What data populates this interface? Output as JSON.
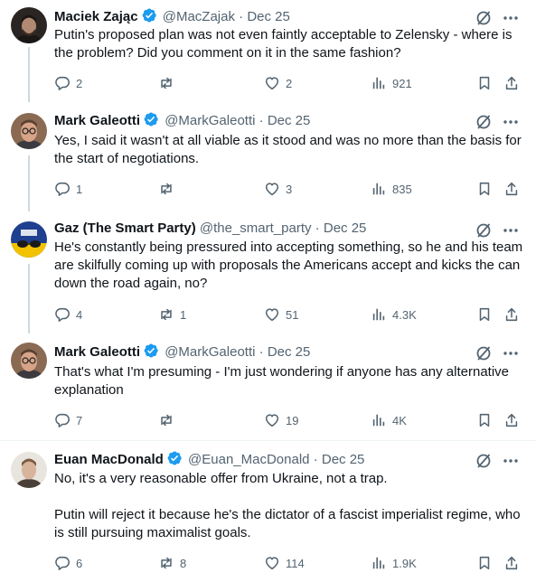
{
  "posts": [
    {
      "name": "Maciek Zając",
      "handle": "@MacZajak",
      "dot": "·",
      "date": "Dec 25",
      "text": "Putin's proposed plan was not even faintly acceptable to Zelensky - where is the problem? Did you comment on it in the same fashion?",
      "replies": "2",
      "reposts": "",
      "likes": "2",
      "views": "921"
    },
    {
      "name": "Mark Galeotti",
      "handle": "@MarkGaleotti",
      "dot": "·",
      "date": "Dec 25",
      "text": "Yes, I said it wasn't at all viable as it stood and was no more than the basis for the start of negotiations.",
      "replies": "1",
      "reposts": "",
      "likes": "3",
      "views": "835"
    },
    {
      "name": "Gaz (The Smart Party)",
      "handle": "@the_smart_party",
      "dot": "·",
      "date": "Dec 25",
      "text": "He's constantly being pressured into accepting something, so he and his team are skilfully coming up with proposals the Americans accept and kicks the can down the road again, no?",
      "replies": "4",
      "reposts": "1",
      "likes": "51",
      "views": "4.3K"
    },
    {
      "name": "Mark Galeotti",
      "handle": "@MarkGaleotti",
      "dot": "·",
      "date": "Dec 25",
      "text": "That's what I'm presuming - I'm just wondering if anyone has any alternative explanation",
      "replies": "7",
      "reposts": "",
      "likes": "19",
      "views": "4K"
    },
    {
      "name": "Euan MacDonald",
      "handle": "@Euan_MacDonald",
      "dot": "·",
      "date": "Dec 25",
      "text": "No, it's a very reasonable offer from Ukraine, not a trap.\n\nPutin will reject it because he's the dictator of a fascist imperialist regime, who is still pursuing maximalist goals.",
      "replies": "6",
      "reposts": "8",
      "likes": "114",
      "views": "1.9K"
    }
  ],
  "colors": {
    "verified": "#1d9bf0",
    "text": "#0f1419",
    "secondary": "#536471",
    "thread_line": "#cfd9de"
  },
  "icons": [
    "verified-badge-icon",
    "grok-icon",
    "more-icon",
    "reply-icon",
    "repost-icon",
    "like-icon",
    "views-icon",
    "bookmark-icon",
    "share-icon"
  ]
}
